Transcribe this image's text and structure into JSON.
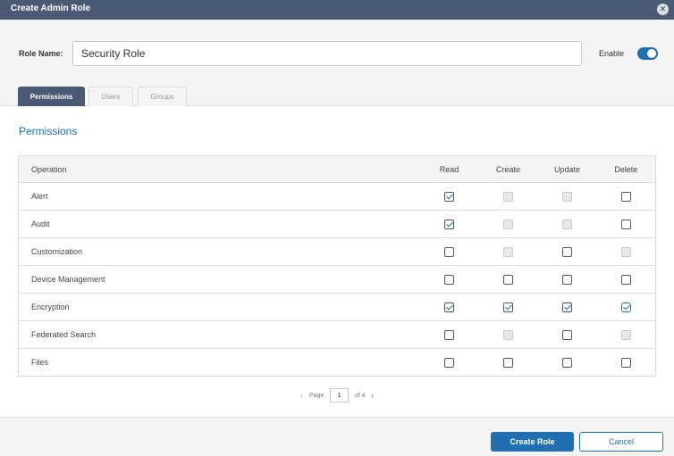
{
  "dialog": {
    "title": "Create Admin Role",
    "close_icon": "close-icon"
  },
  "role": {
    "label": "Role Name:",
    "value": "Security Role",
    "enable_label": "Enable",
    "enabled": true
  },
  "tabs": [
    {
      "label": "Permissions",
      "active": true
    },
    {
      "label": "Users",
      "active": false
    },
    {
      "label": "Groups",
      "active": false
    }
  ],
  "section": {
    "title": "Permissions"
  },
  "table": {
    "headers": {
      "operation": "Operation",
      "read": "Read",
      "create": "Create",
      "update": "Update",
      "delete": "Delete"
    },
    "rows": [
      {
        "operation": "Alert",
        "read": "checked",
        "create": "disabled",
        "update": "disabled",
        "delete": "unchecked"
      },
      {
        "operation": "Audit",
        "read": "checked",
        "create": "disabled",
        "update": "disabled",
        "delete": "unchecked"
      },
      {
        "operation": "Customization",
        "read": "unchecked",
        "create": "disabled",
        "update": "unchecked",
        "delete": "disabled"
      },
      {
        "operation": "Device Management",
        "read": "unchecked",
        "create": "unchecked",
        "update": "unchecked",
        "delete": "unchecked"
      },
      {
        "operation": "Encryption",
        "read": "checked",
        "create": "checked",
        "update": "checked",
        "delete": "checked-highlighted"
      },
      {
        "operation": "Federated Search",
        "read": "unchecked",
        "create": "disabled",
        "update": "unchecked",
        "delete": "disabled"
      },
      {
        "operation": "Files",
        "read": "unchecked",
        "create": "unchecked",
        "update": "unchecked",
        "delete": "unchecked"
      }
    ]
  },
  "pagination": {
    "prev_icon": "chevron-left-icon",
    "label": "Page",
    "current": "1",
    "total": "of 4",
    "next_icon": "chevron-right-icon"
  },
  "footer": {
    "create_label": "Create Role",
    "cancel_label": "Cancel"
  },
  "colors": {
    "header": "#4a5974",
    "accent": "#1f6fb2",
    "panel": "#f4f4f4"
  }
}
